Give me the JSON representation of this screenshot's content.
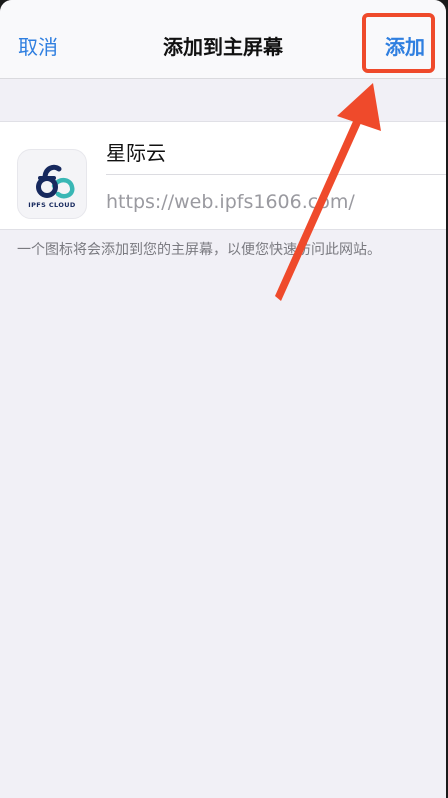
{
  "navbar": {
    "cancel_label": "取消",
    "title": "添加到主屏幕",
    "add_label": "添加"
  },
  "shortcut": {
    "name": "星际云",
    "url": "https://web.ipfs1606.com/",
    "icon": {
      "name": "ipfs-cloud-logo-icon",
      "brand_text": "IPFS CLOUD"
    }
  },
  "footnote": "一个图标将会添加到您的主屏幕，以便您快速访问此网站。",
  "annotations": {
    "highlight_color": "#ef4a2b",
    "arrow_color": "#ef4a2b"
  },
  "colors": {
    "accent": "#2f7fe0",
    "background": "#f1f0f6"
  }
}
